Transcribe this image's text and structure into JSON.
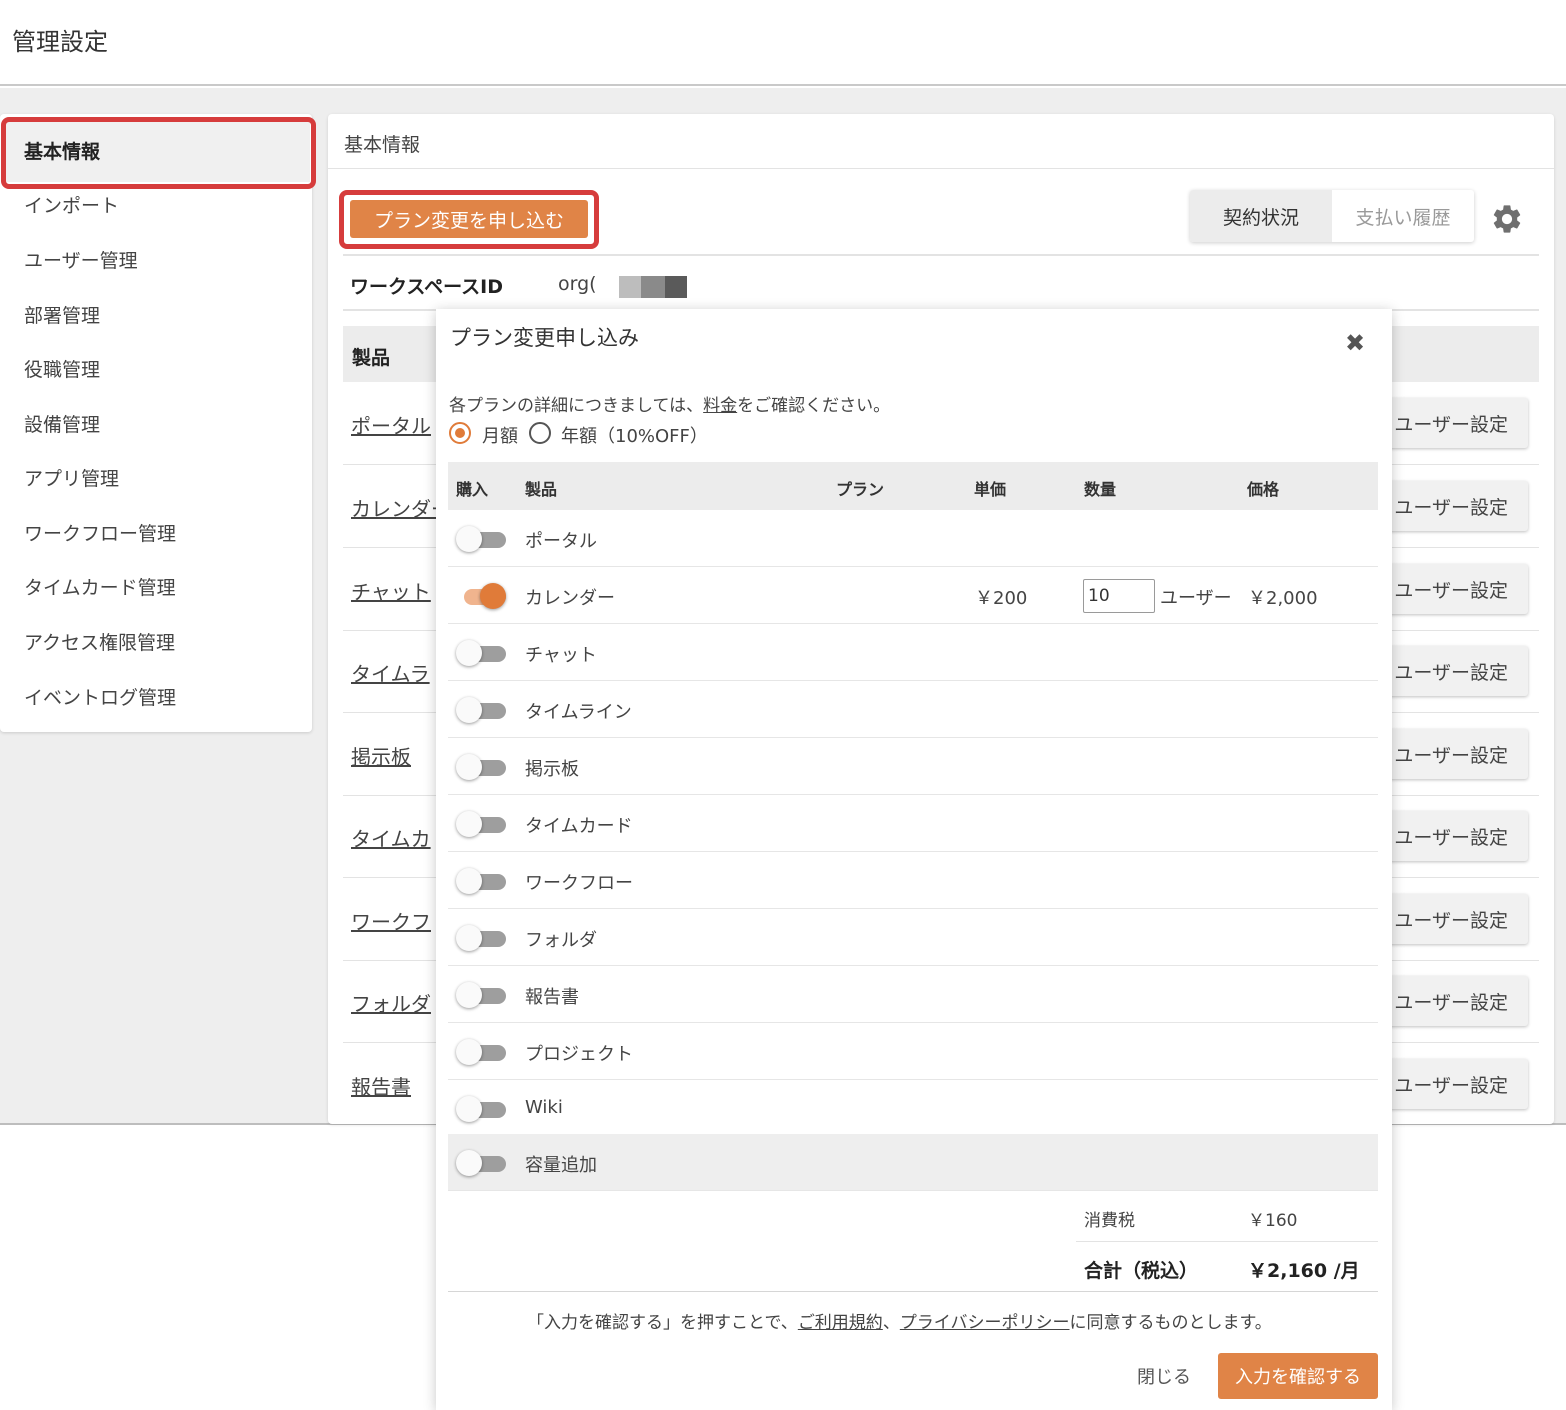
{
  "header": {
    "title": "管理設定"
  },
  "sidebar": {
    "items": [
      {
        "label": "基本情報",
        "active": true
      },
      {
        "label": "インポート"
      },
      {
        "label": "ユーザー管理"
      },
      {
        "label": "部署管理"
      },
      {
        "label": "役職管理"
      },
      {
        "label": "設備管理"
      },
      {
        "label": "アプリ管理"
      },
      {
        "label": "ワークフロー管理"
      },
      {
        "label": "タイムカード管理"
      },
      {
        "label": "アクセス権限管理"
      },
      {
        "label": "イベントログ管理"
      }
    ]
  },
  "main": {
    "title": "基本情報",
    "plan_change_button": "プラン変更を申し込む",
    "tabs": [
      {
        "label": "契約状況",
        "active": true
      },
      {
        "label": "支払い履歴"
      }
    ],
    "workspace_label": "ワークスペースID",
    "workspace_value": "org(",
    "table_header": "製品",
    "products": [
      {
        "label": "ポータル"
      },
      {
        "label": "カレンダー"
      },
      {
        "label": "チャット"
      },
      {
        "label": "タイムラ"
      },
      {
        "label": "掲示板"
      },
      {
        "label": "タイムカ"
      },
      {
        "label": "ワークフ"
      },
      {
        "label": "フォルダ"
      },
      {
        "label": "報告書"
      }
    ],
    "user_settings_label": "ユーザー設定"
  },
  "modal": {
    "title": "プラン変更申し込み",
    "close_symbol": "✖",
    "notice_before": "各プランの詳細につきましては、",
    "notice_link": "料金",
    "notice_after": "をご確認ください。",
    "billing_options": [
      {
        "label": "月額",
        "selected": true
      },
      {
        "label": "年額（10%OFF）",
        "selected": false
      }
    ],
    "columns": {
      "purchase": "購入",
      "product": "製品",
      "plan": "プラン",
      "unit_price": "単価",
      "quantity": "数量",
      "price": "価格"
    },
    "rows": [
      {
        "product": "ポータル",
        "on": false
      },
      {
        "product": "カレンダー",
        "on": true,
        "unit_price": "￥200",
        "quantity": "10",
        "quantity_unit": "ユーザー",
        "price": "￥2,000"
      },
      {
        "product": "チャット",
        "on": false
      },
      {
        "product": "タイムライン",
        "on": false
      },
      {
        "product": "掲示板",
        "on": false
      },
      {
        "product": "タイムカード",
        "on": false
      },
      {
        "product": "ワークフロー",
        "on": false
      },
      {
        "product": "フォルダ",
        "on": false
      },
      {
        "product": "報告書",
        "on": false
      },
      {
        "product": "プロジェクト",
        "on": false
      },
      {
        "product": "Wiki",
        "on": false
      },
      {
        "product": "容量追加",
        "on": false,
        "shaded": true
      }
    ],
    "tax_label": "消費税",
    "tax_value": "￥160",
    "total_label": "合計（税込）",
    "total_value": "￥2,160 /月",
    "terms_prefix": "「入力を確認する」を押すことで、",
    "terms_link1": "ご利用規約",
    "terms_sep": "、",
    "terms_link2": "プライバシーポリシー",
    "terms_suffix": "に同意するものとします。",
    "close_button": "閉じる",
    "confirm_button": "入力を確認する"
  },
  "colors": {
    "accent": "#e08447",
    "highlight_box": "#d63c3c",
    "toggle_on": "#e07b39"
  }
}
